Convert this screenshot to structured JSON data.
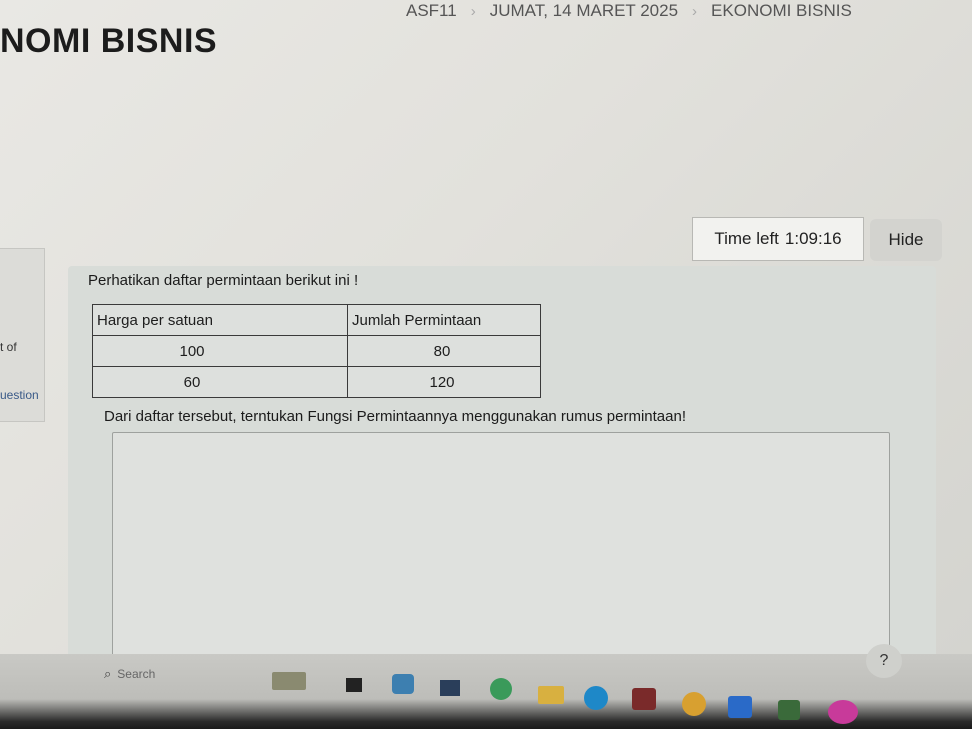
{
  "breadcrumb": [
    "ASF11",
    "JUMAT, 14 MARET 2025",
    "EKONOMI BISNIS"
  ],
  "page_title": "NOMI BISNIS",
  "timer": {
    "label": "Time left",
    "value": "1:09:16"
  },
  "hide_label": "Hide",
  "sidebar": {
    "text1": "t of",
    "text2": "uestion"
  },
  "question": {
    "intro": "Perhatikan daftar permintaan berikut ini !",
    "table": {
      "headers": [
        "Harga per satuan",
        "Jumlah Permintaan"
      ],
      "rows": [
        [
          "100",
          "80"
        ],
        [
          "60",
          "120"
        ]
      ]
    },
    "task": "Dari daftar tersebut, terntukan Fungsi Permintaannya menggunakan rumus permintaan!"
  },
  "help_label": "?",
  "taskbar": {
    "search_placeholder": "Search",
    "apps": [
      "calendar-app-icon",
      "terminal-icon",
      "photos-icon",
      "calculator-icon",
      "whatsapp-icon",
      "folder-icon",
      "edge-icon",
      "store-icon",
      "chrome-icon",
      "zoom-icon",
      "media-icon",
      "onenote-icon"
    ]
  }
}
